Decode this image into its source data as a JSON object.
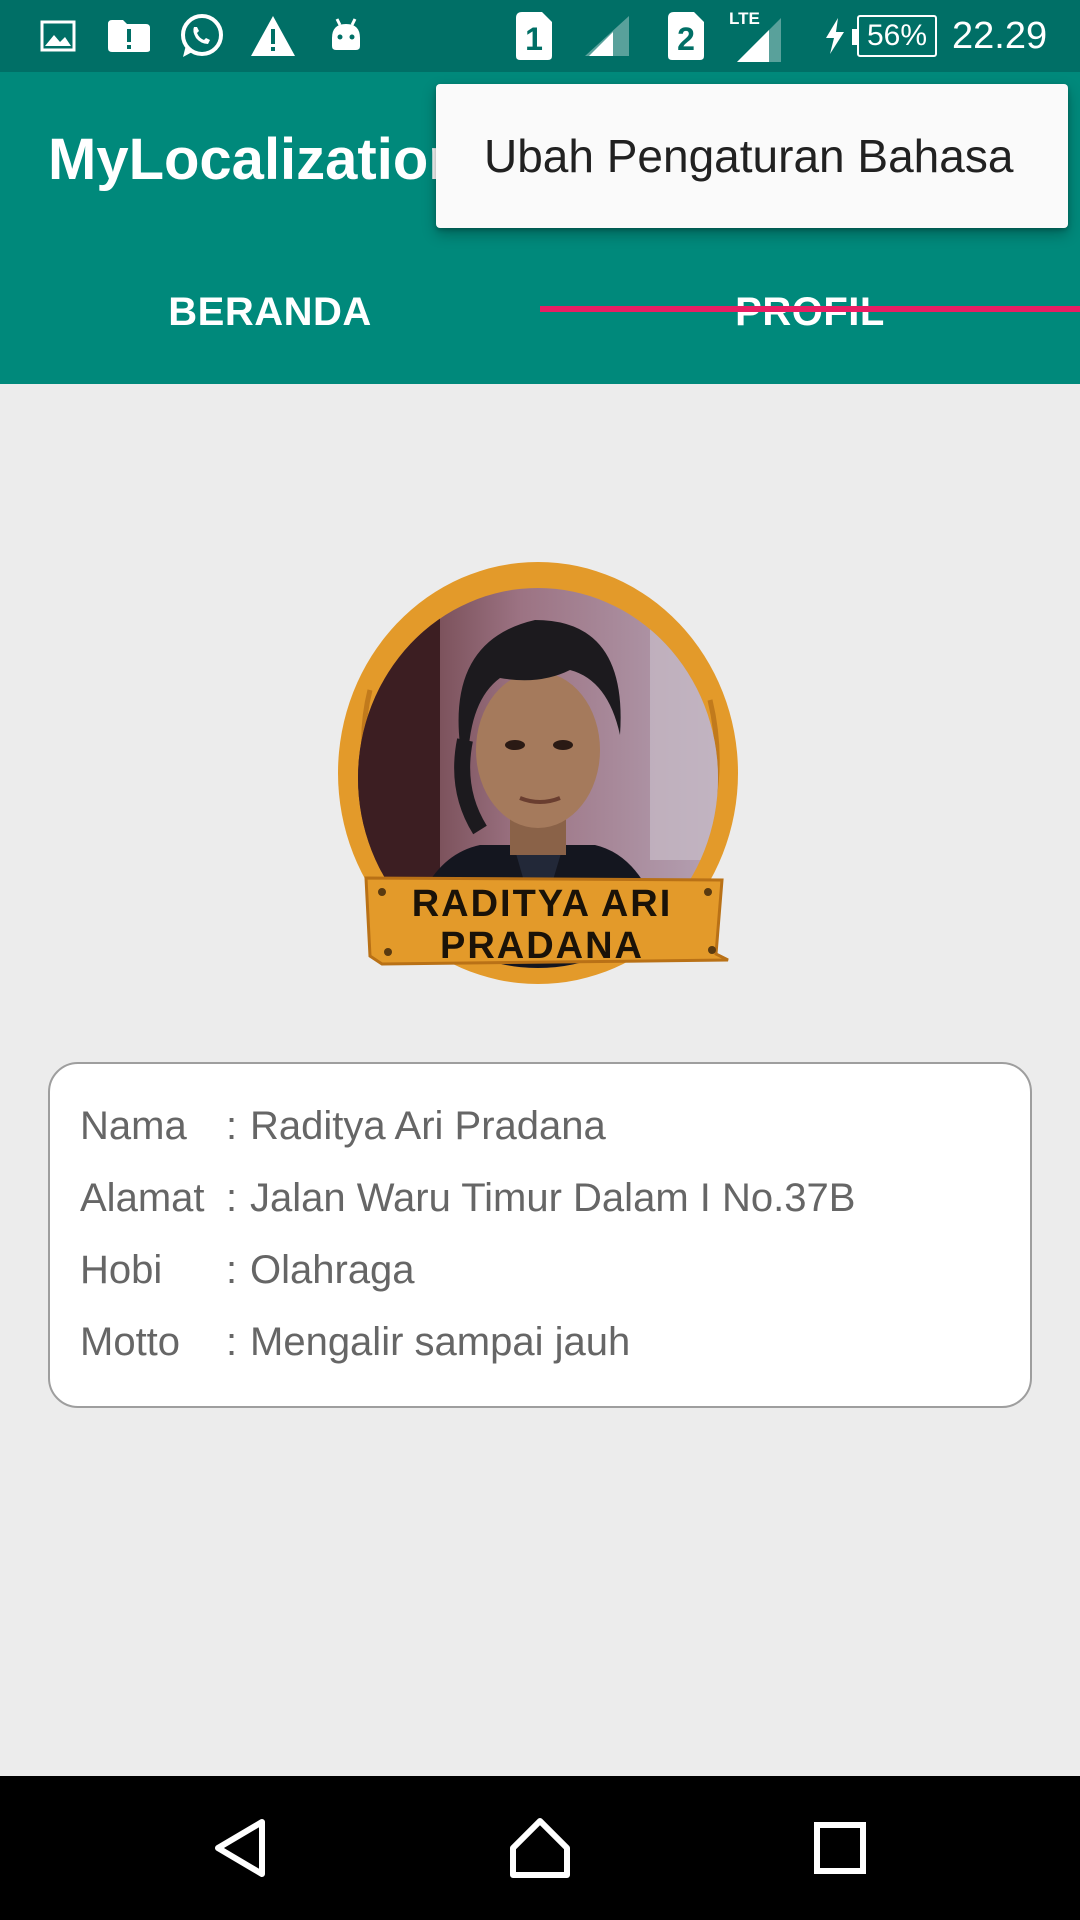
{
  "status_bar": {
    "sim1_label": "1",
    "sim2_label": "2",
    "network_type": "LTE",
    "battery_percent": "56%",
    "time": "22.29"
  },
  "app_bar": {
    "title": "MyLocalization"
  },
  "overflow_menu": {
    "items": [
      {
        "label": "Ubah Pengaturan Bahasa"
      }
    ]
  },
  "tabs": [
    {
      "label": "BERANDA",
      "selected": false
    },
    {
      "label": "PROFIL",
      "selected": true
    }
  ],
  "profile": {
    "badge_name_line1": "RADITYA ARI",
    "badge_name_line2": "PRADANA",
    "rows": [
      {
        "label": "Nama",
        "separator": ":",
        "value": "Raditya Ari Pradana"
      },
      {
        "label": "Alamat",
        "separator": ":",
        "value": "Jalan Waru Timur Dalam I No.37B"
      },
      {
        "label": "Hobi",
        "separator": ":",
        "value": "Olahraga"
      },
      {
        "label": "Motto",
        "separator": ":",
        "value": "Mengalir sampai jauh"
      }
    ]
  },
  "nav_bar": {
    "icons": [
      "back-icon",
      "home-icon",
      "recents-icon"
    ]
  },
  "colors": {
    "status_bar": "#006f66",
    "app_bar": "#00897b",
    "tab_indicator": "#e91e63",
    "background": "#ececec",
    "badge_wood": "#e39a2a"
  }
}
